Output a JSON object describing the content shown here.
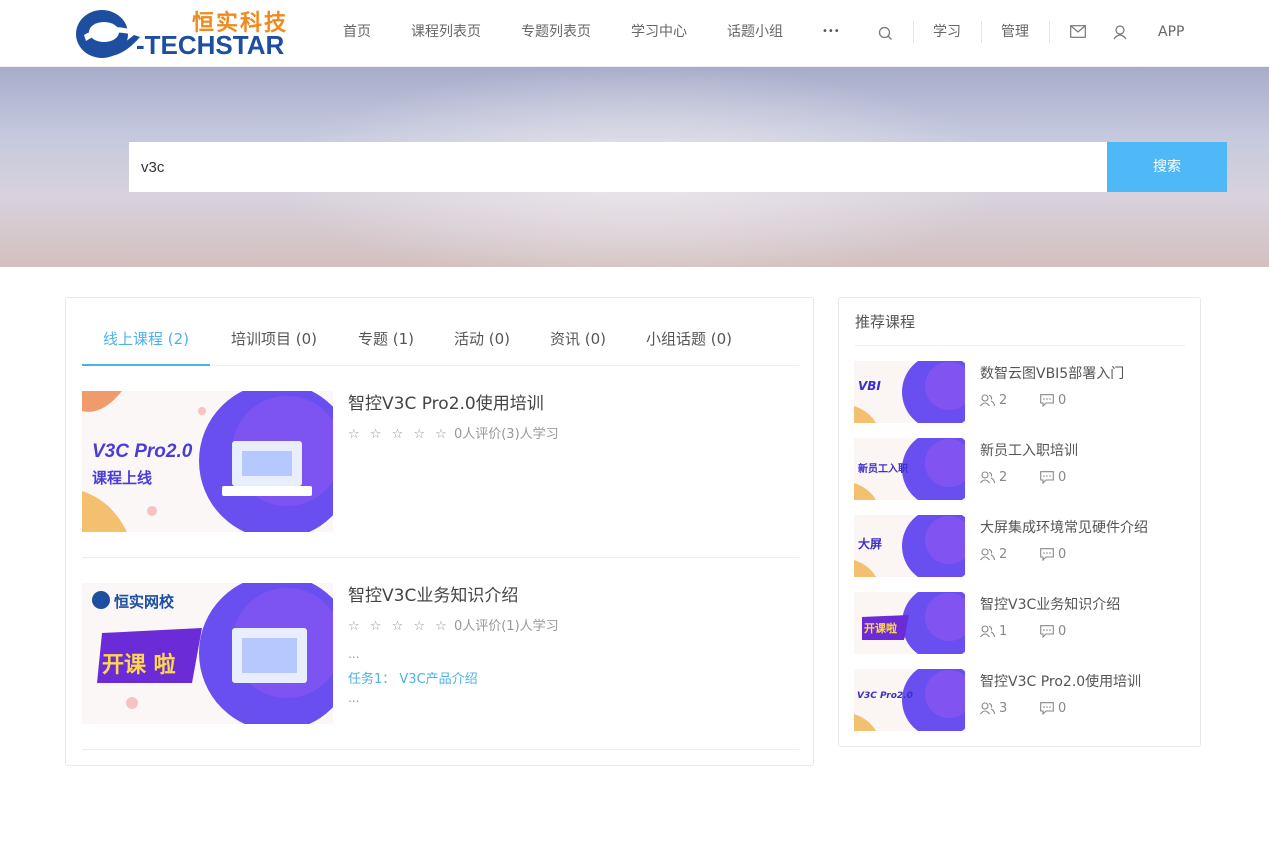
{
  "header": {
    "logo_cn": "恒实科技",
    "logo_en": "-TECHSTAR",
    "nav": [
      "首页",
      "课程列表页",
      "专题列表页",
      "学习中心",
      "话题小组"
    ],
    "more_label": "•••",
    "study_label": "学习",
    "manage_label": "管理",
    "app_label": "APP"
  },
  "search": {
    "value": "v3c",
    "button_label": "搜索"
  },
  "tabs": [
    {
      "label": "线上课程 (2)",
      "active": true
    },
    {
      "label": "培训项目 (0)",
      "active": false
    },
    {
      "label": "专题 (1)",
      "active": false
    },
    {
      "label": "活动 (0)",
      "active": false
    },
    {
      "label": "资讯 (0)",
      "active": false
    },
    {
      "label": "小组话题 (0)",
      "active": false
    }
  ],
  "courses": [
    {
      "title": "智控V3C Pro2.0使用培训",
      "stars": "☆ ☆ ☆ ☆ ☆",
      "reviews": "0人评价",
      "learners": "(3)人学习",
      "thumb_text_1": "V3C Pro2.0",
      "thumb_text_2": "课程上线"
    },
    {
      "title": "智控V3C业务知识介绍",
      "stars": "☆ ☆ ☆ ☆ ☆",
      "reviews": "0人评价",
      "learners": "(1)人学习",
      "ellipsis_top": "...",
      "task": "任务1： V3C产品介绍",
      "ellipsis_bottom": "...",
      "thumb_text_1": "恒实网校",
      "thumb_text_2": "开课 啦"
    }
  ],
  "sidebar": {
    "title": "推荐课程",
    "items": [
      {
        "title": "数智云图VBI5部署入门",
        "students": "2",
        "comments": "0",
        "thumb_text": "VBI"
      },
      {
        "title": "新员工入职培训",
        "students": "2",
        "comments": "0",
        "thumb_text": "新员工入职"
      },
      {
        "title": "大屏集成环境常见硬件介绍",
        "students": "2",
        "comments": "0",
        "thumb_text": "大屏"
      },
      {
        "title": "智控V3C业务知识介绍",
        "students": "1",
        "comments": "0",
        "thumb_text": "开课啦"
      },
      {
        "title": "智控V3C Pro2.0使用培训",
        "students": "3",
        "comments": "0",
        "thumb_text": "V3C Pro2.0"
      }
    ]
  },
  "colors": {
    "accent": "#4fb9f7",
    "link": "#4fb0e8",
    "logo_orange": "#f08a1c",
    "logo_blue": "#1d4ea0"
  }
}
